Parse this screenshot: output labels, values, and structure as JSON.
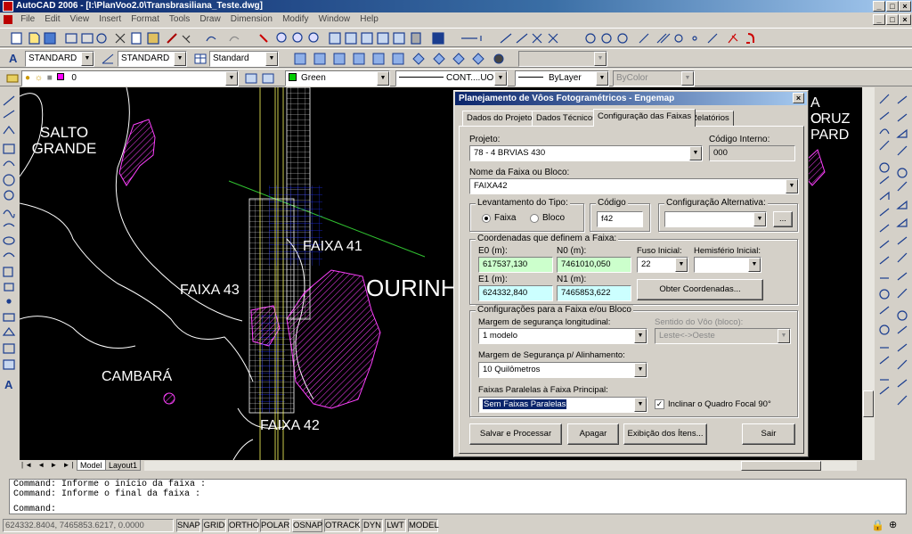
{
  "app": {
    "title": "AutoCAD 2006 - [I:\\PlanVoo2.0\\Transbrasiliana_Teste.dwg]"
  },
  "menu": [
    "File",
    "Edit",
    "View",
    "Insert",
    "Format",
    "Tools",
    "Draw",
    "Dimension",
    "Modify",
    "Window",
    "Help"
  ],
  "styles_toolbar": {
    "text_style": "STANDARD",
    "dim_style": "STANDARD",
    "table_style": "Standard"
  },
  "layers_toolbar": {
    "layer": "0",
    "color": "Green",
    "linetype": "CONT....UOUS",
    "lineweight": "ByLayer",
    "plotstyle": "ByColor"
  },
  "drawing": {
    "labels": [
      "SALTO\nGRANDE",
      "FAIXA 41",
      "FAIXA 43",
      "OURINH",
      "CAMBARÁ",
      "FAIXA 42",
      "A CRUZ",
      "O PARD"
    ]
  },
  "dialog": {
    "title": "Planejamento de Vôos Fotogramétricos - Engemap",
    "tabs": [
      "Dados do Projeto",
      "Dados Técnicos",
      "Configuração das Faixas",
      "Relatórios"
    ],
    "projeto_label": "Projeto:",
    "projeto_value": "78 - 4 BRVIAS 430",
    "codigo_interno_label": "Código Interno:",
    "codigo_interno_value": "000",
    "nome_faixa_label": "Nome da Faixa ou Bloco:",
    "nome_faixa_value": "FAIXA42",
    "levantamento_label": "Levantamento do Tipo:",
    "radio_faixa": "Faixa",
    "radio_bloco": "Bloco",
    "codigo_label": "Código",
    "codigo_value": "f42",
    "config_alt_label": "Configuração Alternativa:",
    "config_alt_btn": "...",
    "coords_group": "Coordenadas que definem a Faixa:",
    "e0_label": "E0 (m):",
    "e0_value": "617537,130",
    "n0_label": "N0 (m):",
    "n0_value": "7461010,050",
    "fuso_label": "Fuso Inicial:",
    "fuso_value": "22",
    "hemisferio_label": "Hemisfério Inicial:",
    "e1_label": "E1 (m):",
    "e1_value": "624332,840",
    "n1_label": "N1 (m):",
    "n1_value": "7465853,622",
    "obter_btn": "Obter Coordenadas...",
    "config_group": "Configurações para a Faixa e/ou Bloco",
    "margem_long_label": "Margem de segurança longitudinal:",
    "margem_long_value": "1 modelo",
    "sentido_label": "Sentido do Vôo (bloco):",
    "sentido_value": "Leste<->Oeste",
    "margem_alinh_label": "Margem de Segurança p/ Alinhamento:",
    "margem_alinh_value": "10 Quilômetros",
    "paralelas_label": "Faixas Paralelas à Faixa Principal:",
    "paralelas_value": "Sem Faixas Paralelas",
    "inclinar_label": "Inclinar o Quadro Focal 90°",
    "btn_salvar": "Salvar e Processar",
    "btn_apagar": "Apagar",
    "btn_exibicao": "Exibição dos Ítens...",
    "btn_sair": "Sair"
  },
  "layout_tabs": [
    "Model",
    "Layout1"
  ],
  "command_lines": [
    "Command: Informe o início da faixa :",
    "Command: Informe o final da faixa :",
    "Command:"
  ],
  "status": {
    "coords": "624332.8404, 7465853.6217, 0.0000",
    "toggles": [
      "SNAP",
      "GRID",
      "ORTHO",
      "POLAR",
      "OSNAP",
      "OTRACK",
      "DYN",
      "LWT",
      "MODEL"
    ]
  }
}
